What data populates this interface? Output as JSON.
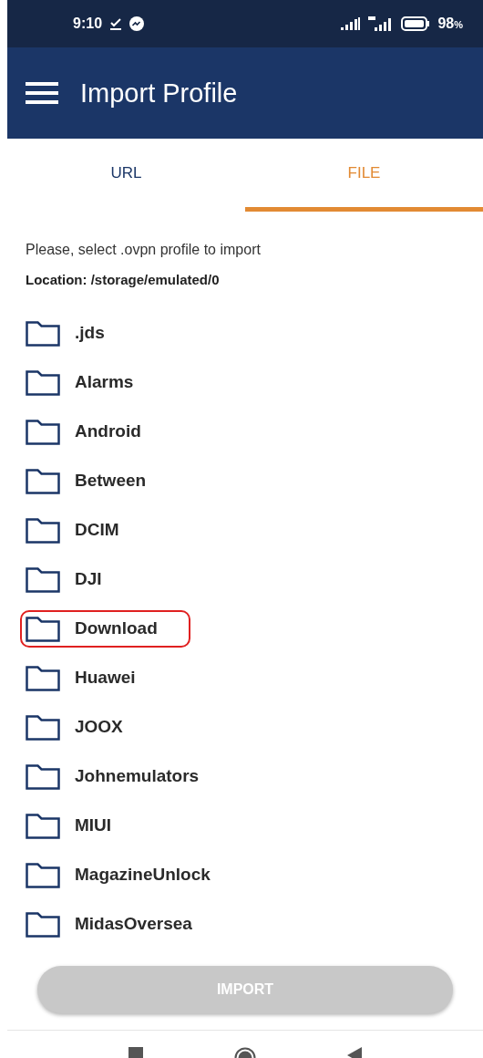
{
  "status_bar": {
    "time": "9:10",
    "battery": "98",
    "battery_unit": "%"
  },
  "app_bar": {
    "title": "Import Profile"
  },
  "tabs": [
    {
      "label": "URL",
      "selected": false
    },
    {
      "label": "FILE",
      "selected": true
    }
  ],
  "instruction": "Please, select .ovpn profile to import",
  "location": "Location: /storage/emulated/0",
  "folders": [
    {
      "name": ".jds",
      "highlighted": false
    },
    {
      "name": "Alarms",
      "highlighted": false
    },
    {
      "name": "Android",
      "highlighted": false
    },
    {
      "name": "Between",
      "highlighted": false
    },
    {
      "name": "DCIM",
      "highlighted": false
    },
    {
      "name": "DJI",
      "highlighted": false
    },
    {
      "name": "Download",
      "highlighted": true
    },
    {
      "name": "Huawei",
      "highlighted": false
    },
    {
      "name": "JOOX",
      "highlighted": false
    },
    {
      "name": "Johnemulators",
      "highlighted": false
    },
    {
      "name": "MIUI",
      "highlighted": false
    },
    {
      "name": "MagazineUnlock",
      "highlighted": false
    },
    {
      "name": "MidasOversea",
      "highlighted": false
    }
  ],
  "import_button": {
    "label": "IMPORT",
    "disabled": true
  }
}
